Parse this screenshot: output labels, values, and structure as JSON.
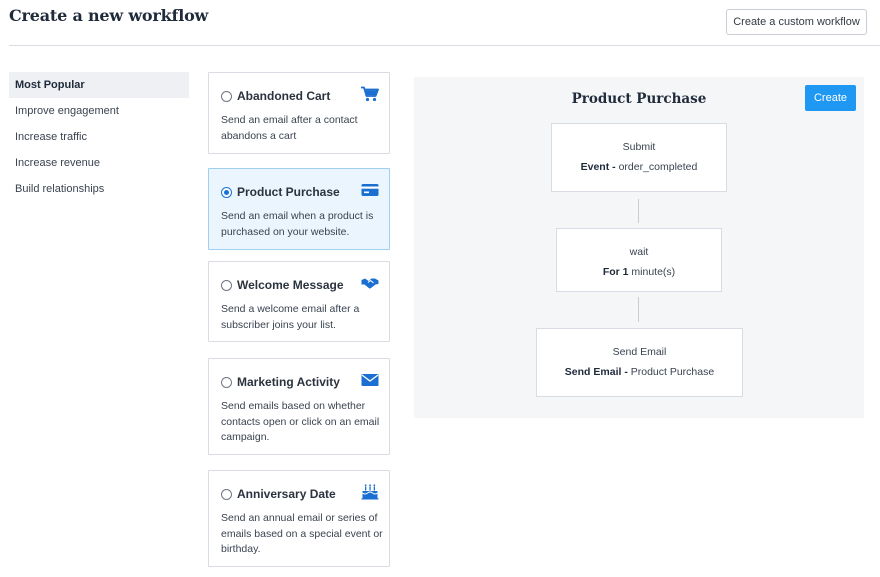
{
  "header": {
    "title": "Create a new workflow",
    "custom_button": "Create a custom workflow"
  },
  "sidebar": {
    "items": [
      {
        "label": "Most Popular",
        "active": true
      },
      {
        "label": "Improve engagement"
      },
      {
        "label": "Increase traffic"
      },
      {
        "label": "Increase revenue"
      },
      {
        "label": "Build relationships"
      }
    ]
  },
  "workflows": [
    {
      "title": "Abandoned Cart",
      "description": "Send an email after a contact abandons a cart",
      "icon": "cart-icon",
      "selected": false
    },
    {
      "title": "Product Purchase",
      "description": "Send an email when a product is purchased on your website.",
      "icon": "credit-card-icon",
      "selected": true
    },
    {
      "title": "Welcome Message",
      "description": "Send a welcome email after a subscriber joins your list.",
      "icon": "handshake-icon",
      "selected": false
    },
    {
      "title": "Marketing Activity",
      "description": "Send emails based on whether contacts open or click on an email campaign.",
      "icon": "envelope-icon",
      "selected": false
    },
    {
      "title": "Anniversary Date",
      "description": "Send an annual email or series of emails based on a special event or birthday.",
      "icon": "cake-icon",
      "selected": false
    }
  ],
  "preview": {
    "title": "Product Purchase",
    "create_button": "Create",
    "steps": [
      {
        "title": "Submit",
        "detail_label": "Event -",
        "detail_value": "order_completed"
      },
      {
        "title": "wait",
        "detail_label": "For 1",
        "detail_value": "minute(s)"
      },
      {
        "title": "Send Email",
        "detail_label": "Send Email -",
        "detail_value": "Product Purchase"
      }
    ]
  },
  "colors": {
    "accent": "#1e98f2",
    "icon_blue": "#1a6fd1",
    "selected_card_bg": "#eaf5fd"
  }
}
